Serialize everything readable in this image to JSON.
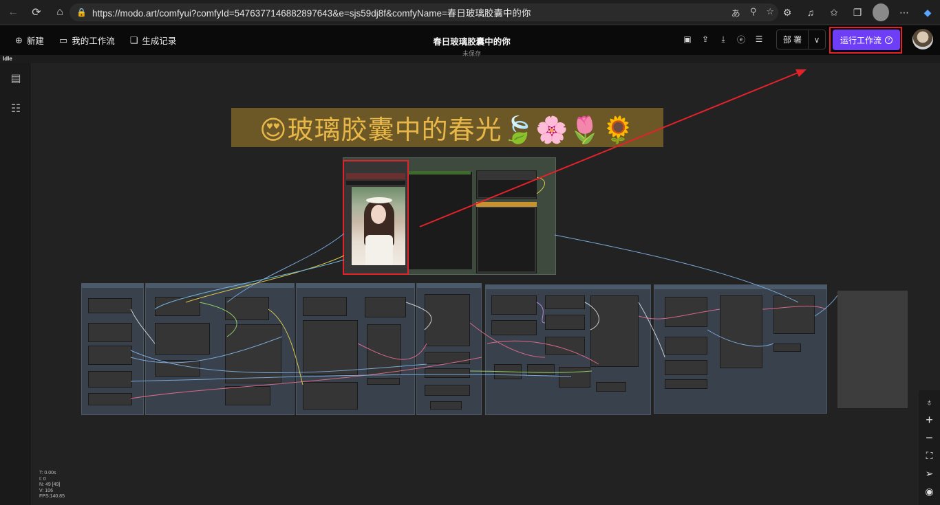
{
  "browser": {
    "url": "https://modo.art/comfyui?comfyId=5476377146882897643&e=sjs59dj8f&comfyName=春日玻璃胶囊中的你"
  },
  "header": {
    "new_label": "新建",
    "my_workflows_label": "我的工作流",
    "history_label": "生成记录",
    "title": "春日玻璃胶囊中的你",
    "subtitle": "未保存",
    "deploy_label": "部 署",
    "run_label": "运行工作流"
  },
  "status": {
    "state": "Idle"
  },
  "canvas": {
    "banner_text": "😍玻璃胶囊中的春光🍃🌸🌷🌻",
    "stats": [
      "T: 0.00s",
      "I: 0",
      "N: 49 [49]",
      "V: 106",
      "FPS:140.85"
    ]
  },
  "colors": {
    "accent": "#6d3ef5",
    "highlight": "#e3222a",
    "banner_bg": "#6b5826",
    "banner_text": "#e8b74a"
  },
  "icons": {
    "sidebar": [
      "document-icon",
      "node-tree-icon"
    ],
    "right_tools": [
      "lightbulb-icon",
      "zoom-in-icon",
      "zoom-out-icon",
      "fit-view-icon",
      "navigate-icon",
      "eye-icon"
    ]
  }
}
